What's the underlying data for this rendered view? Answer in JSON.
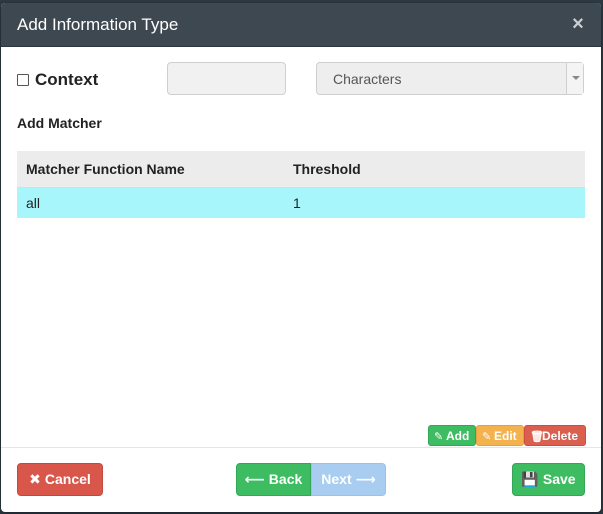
{
  "modal": {
    "title": "Add Information Type",
    "close_glyph": "×"
  },
  "form": {
    "context_label": "Context",
    "context_checked": false,
    "text_value": "",
    "select_value": "Characters"
  },
  "matcher": {
    "section_title": "Add Matcher",
    "columns": [
      "Matcher Function Name",
      "Threshold"
    ],
    "rows": [
      {
        "name": "all",
        "threshold": "1"
      }
    ],
    "selected_row_color": "#a6f6fb"
  },
  "row_actions": {
    "add": "Add",
    "edit": "Edit",
    "delete": "Delete"
  },
  "footer": {
    "cancel": "Cancel",
    "back": "Back",
    "next": "Next",
    "save": "Save"
  },
  "icons": {
    "close": "close-icon",
    "pencil": "pencil-icon",
    "trash": "trash-icon",
    "times": "times-icon",
    "arrow_left": "arrow-left-icon",
    "arrow_right": "arrow-right-icon",
    "floppy": "floppy-disk-icon"
  },
  "colors": {
    "header_bg": "#3d4850",
    "success": "#3ebc62",
    "warning": "#f4b24f",
    "danger": "#db5f4f",
    "disabled_primary": "#a8cdf1"
  }
}
